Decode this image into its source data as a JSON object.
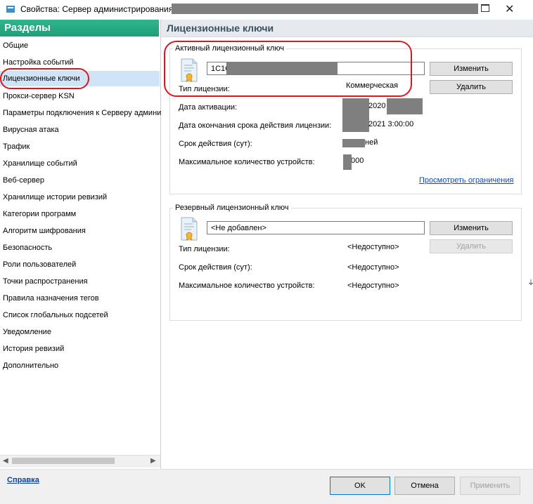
{
  "window": {
    "title": "Свойства: Сервер администрирования"
  },
  "sidebar": {
    "header": "Разделы",
    "items": [
      {
        "label": "Общие"
      },
      {
        "label": "Настройка событий"
      },
      {
        "label": "Лицензионные ключи"
      },
      {
        "label": "Прокси-сервер KSN"
      },
      {
        "label": "Параметры подключения к Серверу админи"
      },
      {
        "label": "Вирусная атака"
      },
      {
        "label": "Трафик"
      },
      {
        "label": "Хранилище событий"
      },
      {
        "label": "Веб-сервер"
      },
      {
        "label": "Хранилище истории ревизий"
      },
      {
        "label": "Категории программ"
      },
      {
        "label": "Алгоритм шифрования"
      },
      {
        "label": "Безопасность"
      },
      {
        "label": "Роли пользователей"
      },
      {
        "label": "Точки распространения"
      },
      {
        "label": "Правила назначения тегов"
      },
      {
        "label": "Список глобальных подсетей"
      },
      {
        "label": "Уведомление"
      },
      {
        "label": "История ревизий"
      },
      {
        "label": "Дополнительно"
      }
    ],
    "selected_index": 2
  },
  "content": {
    "title": "Лицензионные ключи",
    "active_key": {
      "group_title": "Активный лицензионный ключ",
      "key_value": "1C1C",
      "change_label": "Изменить",
      "delete_label": "Удалить",
      "license_type_label": "Тип лицензии:",
      "license_type_value": "Коммерческая",
      "activation_date_label": "Дата активации:",
      "activation_date_value": "2020",
      "expiry_label": "Дата окончания срока действия лицензии:",
      "expiry_value": "2021 3:00:00",
      "validity_label": "Срок действия (сут):",
      "validity_value": "ней",
      "max_devices_label": "Максимальное количество устройств:",
      "max_devices_value": "000",
      "view_limits_link": "Просмотреть ограничения"
    },
    "reserve_key": {
      "group_title": "Резервный лицензионный ключ",
      "key_value": "<Не добавлен>",
      "change_label": "Изменить",
      "delete_label": "Удалить",
      "license_type_label": "Тип лицензии:",
      "license_type_value": "<Недоступно>",
      "validity_label": "Срок действия (сут):",
      "validity_value": "<Недоступно>",
      "max_devices_label": "Максимальное количество устройств:",
      "max_devices_value": "<Недоступно>"
    }
  },
  "footer": {
    "help_link": "Справка",
    "ok_label": "OK",
    "cancel_label": "Отмена",
    "apply_label": "Применить"
  },
  "colors": {
    "sidebar_header": "#1e9f79",
    "selected_item": "#cfe4f7",
    "highlight_oval": "#e0161f",
    "link": "#0a4cb8"
  }
}
